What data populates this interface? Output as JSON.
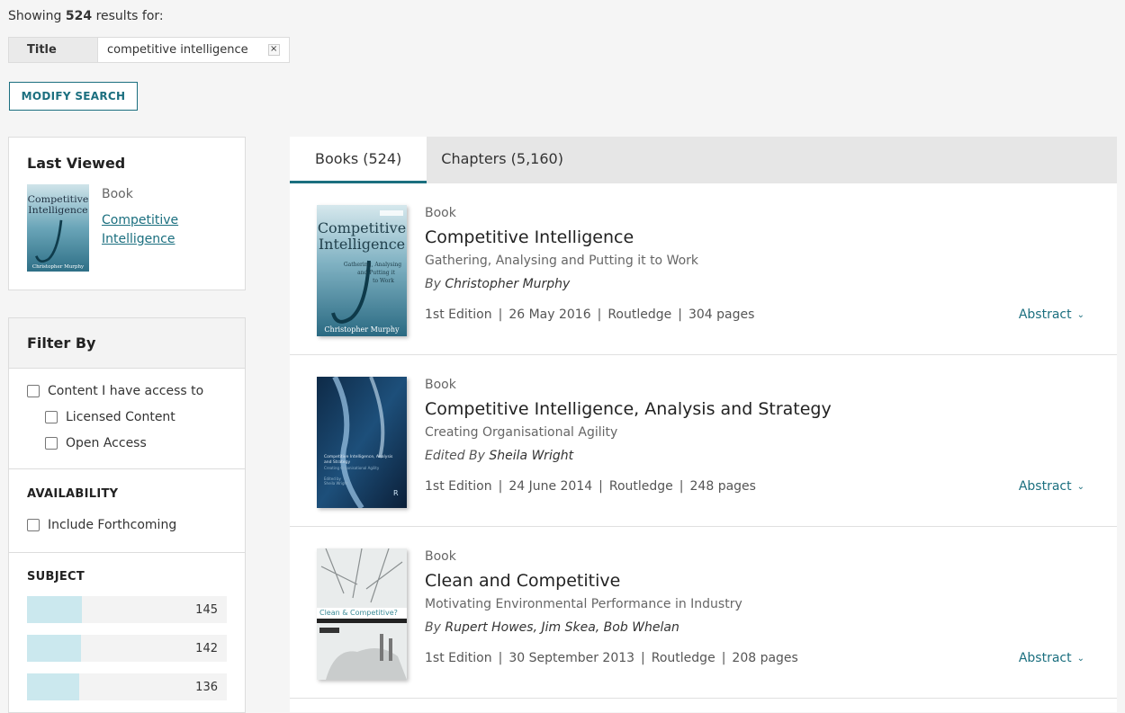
{
  "header": {
    "showing_prefix": "Showing",
    "count": "524",
    "showing_suffix": "results for:",
    "term_field": "Title",
    "term_value": "competitive intelligence",
    "remove_label": "×",
    "modify_label": "MODIFY SEARCH"
  },
  "last_viewed": {
    "title": "Last Viewed",
    "type": "Book",
    "link": "Competitive Intelligence",
    "cover_title": "Competitive Intelligence",
    "cover_author": "Christopher Murphy"
  },
  "filter": {
    "title": "Filter By",
    "access_label": "Content I have access to",
    "licensed_label": "Licensed Content",
    "open_label": "Open Access",
    "availability_title": "AVAILABILITY",
    "forthcoming_label": "Include Forthcoming",
    "subject_title": "SUBJECT",
    "subjects": [
      {
        "count": "145",
        "fraction": 0.276
      },
      {
        "count": "142",
        "fraction": 0.27
      },
      {
        "count": "136",
        "fraction": 0.26
      }
    ]
  },
  "tabs": [
    {
      "label": "Books  (524)"
    },
    {
      "label": "Chapters  (5,160)"
    }
  ],
  "results": [
    {
      "type": "Book",
      "title": "Competitive Intelligence",
      "subtitle": "Gathering, Analysing and Putting it to Work",
      "by_prefix": "By",
      "names": "Christopher Murphy",
      "edition": "1st Edition",
      "date": "26 May 2016",
      "publisher": "Routledge",
      "pages": "304 pages",
      "abstract": "Abstract"
    },
    {
      "type": "Book",
      "title": "Competitive Intelligence, Analysis and Strategy",
      "subtitle": "Creating Organisational Agility",
      "by_prefix": "Edited By",
      "names": "Sheila Wright",
      "edition": "1st Edition",
      "date": "24 June 2014",
      "publisher": "Routledge",
      "pages": "248 pages",
      "abstract": "Abstract"
    },
    {
      "type": "Book",
      "title": "Clean and Competitive",
      "subtitle": "Motivating Environmental Performance in Industry",
      "by_prefix": "By",
      "names": "Rupert Howes, Jim Skea, Bob Whelan",
      "edition": "1st Edition",
      "date": "30 September 2013",
      "publisher": "Routledge",
      "pages": "208 pages",
      "abstract": "Abstract"
    }
  ],
  "cover_text": {
    "c1_title": "Competitive Intelligence",
    "c1_sub": "Gathering, Analysing and Putting it to Work",
    "c1_author": "Christopher Murphy",
    "c2_title": "Competitive Intelligence, Analysis and Strategy",
    "c2_sub": "Creating Organisational Agility",
    "c2_author": "Edited by Sheila Wright",
    "c3_title": "Clean & Competitive?"
  }
}
